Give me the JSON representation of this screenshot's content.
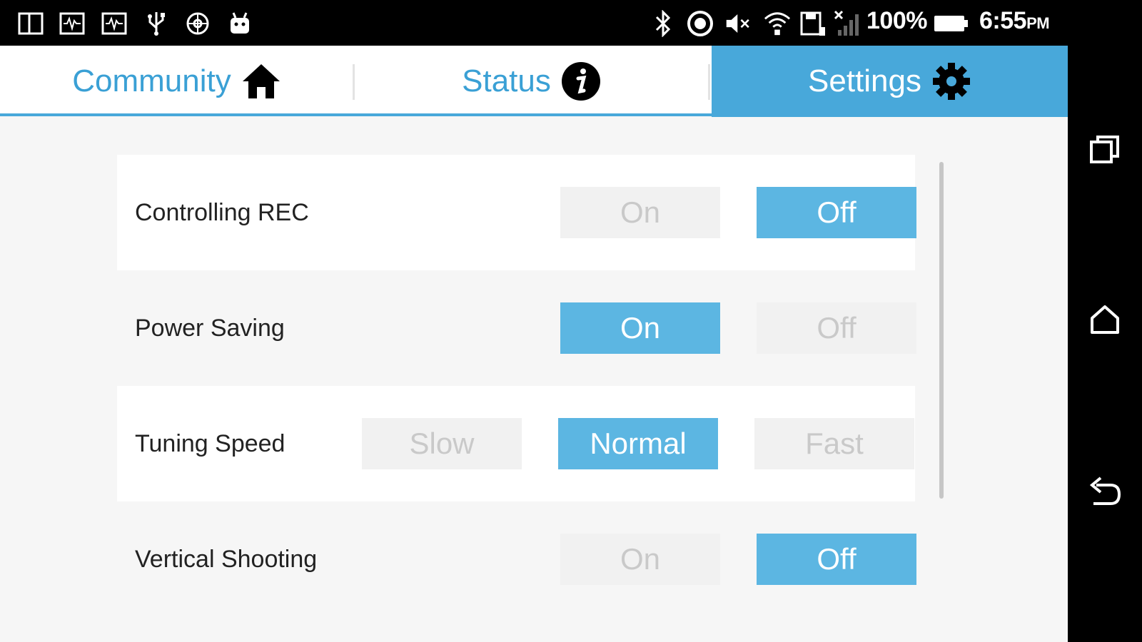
{
  "status_bar": {
    "battery_percent": "100%",
    "time": "6:55",
    "ampm": "PM",
    "left_icons": [
      "notification-box-icon",
      "waveform-icon",
      "waveform-icon",
      "usb-icon",
      "settings-flower-icon",
      "android-icon"
    ],
    "right_icons": [
      "bluetooth-icon",
      "sync-icon",
      "volume-muted-icon",
      "wifi-icon",
      "save-icon",
      "signal-off-icon",
      "battery-icon"
    ]
  },
  "tabs": [
    {
      "label": "Community",
      "icon": "home-icon",
      "active": false
    },
    {
      "label": "Status",
      "icon": "info-icon",
      "active": false
    },
    {
      "label": "Settings",
      "icon": "gear-icon",
      "active": true
    }
  ],
  "settings": [
    {
      "label": "Controlling REC",
      "options": [
        "On",
        "Off"
      ],
      "selected": "Off"
    },
    {
      "label": "Power Saving",
      "options": [
        "On",
        "Off"
      ],
      "selected": "On"
    },
    {
      "label": "Tuning Speed",
      "options": [
        "Slow",
        "Normal",
        "Fast"
      ],
      "selected": "Normal"
    },
    {
      "label": "Vertical Shooting",
      "options": [
        "On",
        "Off"
      ],
      "selected": "Off"
    }
  ],
  "nav": [
    "recent-apps-icon",
    "home-nav-icon",
    "back-icon"
  ],
  "colors": {
    "accent": "#48a8da",
    "selected": "#5cb6e2",
    "unselected_bg": "#f1f1f1",
    "unselected_text": "#c9c9c9"
  }
}
